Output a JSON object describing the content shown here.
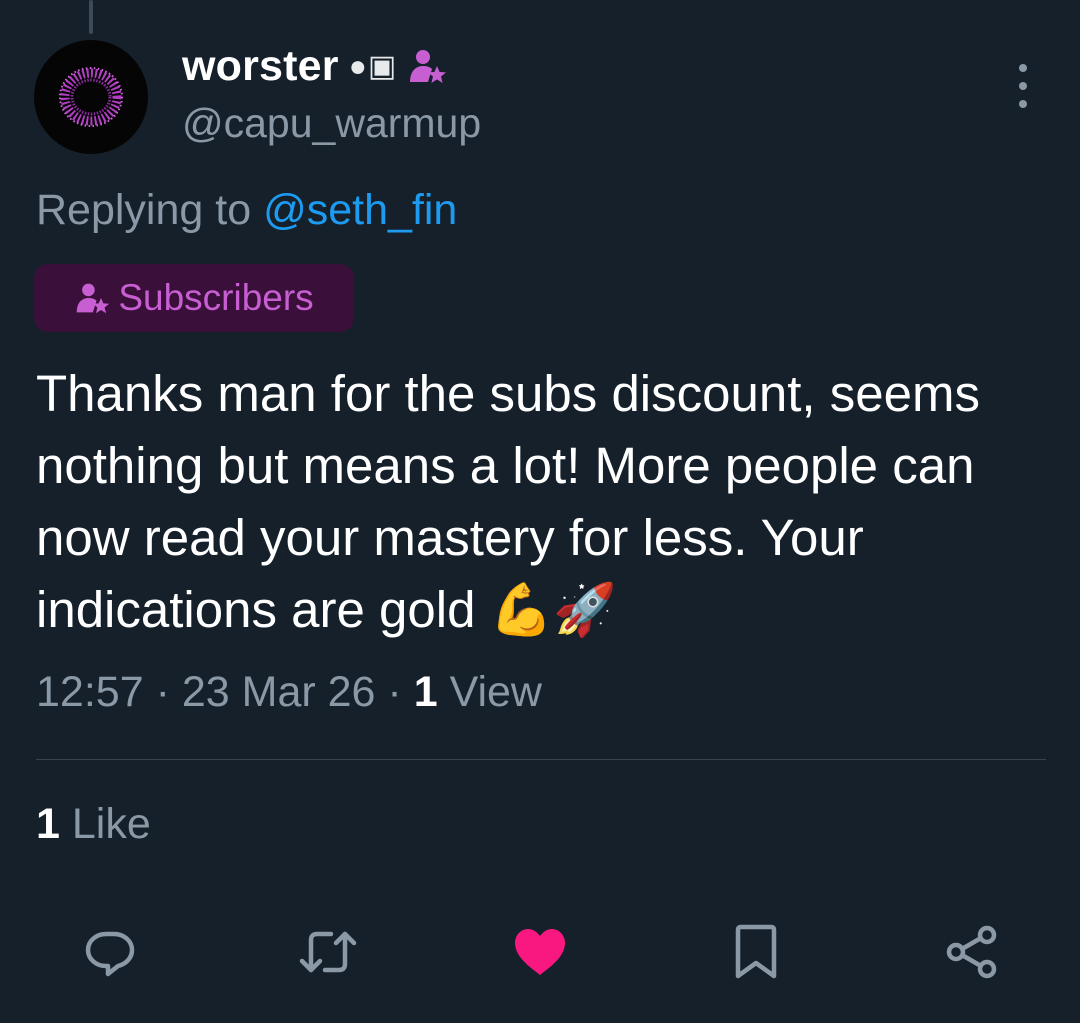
{
  "author": {
    "display_name": "worster",
    "name_glyphs": "●▣",
    "handle": "@capu_warmup",
    "avatar_icon": "purple-ring-avatar",
    "subscriber_icon": "subscriber-star-icon"
  },
  "reply": {
    "prefix": "Replying to",
    "mention": "@seth_fin"
  },
  "audience_badge": {
    "label": "Subscribers",
    "icon": "subscriber-star-icon"
  },
  "tweet": {
    "text": "Thanks man for the subs discount, seems nothing but means a lot! More people can now read your mastery for less. Your indications are gold 💪🚀",
    "time": "12:57",
    "date": "23 Mar 26",
    "views_count": "1",
    "views_label": "View",
    "separator": "·"
  },
  "engagement": {
    "likes_count": "1",
    "likes_label": "Like"
  },
  "actions": {
    "reply_icon": "reply-icon",
    "retweet_icon": "retweet-icon",
    "like_icon": "heart-icon",
    "bookmark_icon": "bookmark-icon",
    "share_icon": "share-icon"
  },
  "colors": {
    "background": "#15202b",
    "muted_text": "#8b98a5",
    "link": "#1d9bf0",
    "like_active": "#f91880",
    "subscriber_purple": "#c75fd3",
    "badge_bg": "#3a0f3a"
  }
}
